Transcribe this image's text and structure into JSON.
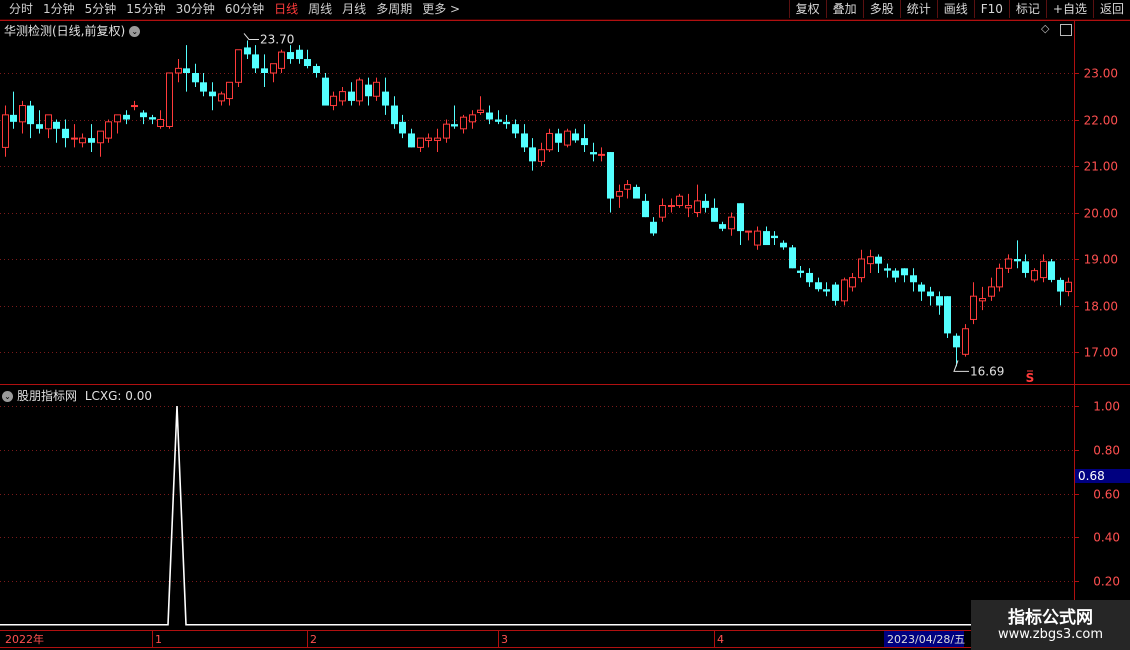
{
  "toolbar": {
    "periods": [
      {
        "label": "分时"
      },
      {
        "label": "1分钟"
      },
      {
        "label": "5分钟"
      },
      {
        "label": "15分钟"
      },
      {
        "label": "30分钟"
      },
      {
        "label": "60分钟"
      },
      {
        "label": "日线"
      },
      {
        "label": "周线"
      },
      {
        "label": "月线"
      },
      {
        "label": "多周期"
      },
      {
        "label": "更多"
      }
    ],
    "more_glyph": ">",
    "active_period": "日线",
    "buttons": [
      "复权",
      "叠加",
      "多股",
      "统计",
      "画线",
      "F10",
      "标记",
      "+自选",
      "返回"
    ]
  },
  "main_panel": {
    "title": "华测检测(日线,前复权)",
    "max_label": "23.70",
    "min_label": "16.69",
    "signal_mark": "S"
  },
  "indicator_panel": {
    "title": "股朋指标网",
    "value_label": "LCXG: 0.00",
    "current_value": "0.68"
  },
  "x_axis": {
    "start_label": "2022年",
    "month_labels": [
      "1",
      "2",
      "3",
      "4"
    ],
    "cursor_date": "2023/04/28/五"
  },
  "watermark": {
    "title": "指标公式网",
    "url": "www.zbgs3.com"
  },
  "colors": {
    "up": "#ff3b3b",
    "down": "#54ffff",
    "grid": "#7a1a1a",
    "axis": "#b01010",
    "label": "#ff5050",
    "indicator_line": "#ffffff",
    "highlight_bg": "#000080"
  },
  "chart_data": [
    {
      "type": "candlestick",
      "title": "华测检测(日线,前复权)",
      "y_ticks": [
        17,
        18,
        19,
        20,
        21,
        22,
        23
      ],
      "ylim": [
        16.5,
        24.0
      ],
      "annotations": [
        {
          "label": "23.70",
          "value": 23.7
        },
        {
          "label": "16.69",
          "value": 16.69
        }
      ],
      "ohlc": [
        [
          21.4,
          22.3,
          21.2,
          22.1
        ],
        [
          22.1,
          22.6,
          21.8,
          21.95
        ],
        [
          21.95,
          22.4,
          21.7,
          22.3
        ],
        [
          22.3,
          22.4,
          21.6,
          21.9
        ],
        [
          21.9,
          22.2,
          21.7,
          21.8
        ],
        [
          21.8,
          22.1,
          21.6,
          22.1
        ],
        [
          21.95,
          22.0,
          21.5,
          21.8
        ],
        [
          21.8,
          22.0,
          21.4,
          21.6
        ],
        [
          21.6,
          21.9,
          21.4,
          21.6
        ],
        [
          21.5,
          21.7,
          21.4,
          21.6
        ],
        [
          21.6,
          21.9,
          21.3,
          21.5
        ],
        [
          21.5,
          21.7,
          21.2,
          21.75
        ],
        [
          21.6,
          22.0,
          21.5,
          21.95
        ],
        [
          21.95,
          22.1,
          21.7,
          22.1
        ],
        [
          22.1,
          22.2,
          21.9,
          22.0
        ],
        [
          22.3,
          22.4,
          22.2,
          22.3
        ],
        [
          22.15,
          22.2,
          21.9,
          22.05
        ],
        [
          22.05,
          22.1,
          21.9,
          22.0
        ],
        [
          21.85,
          22.2,
          21.8,
          22.0
        ],
        [
          21.85,
          23.0,
          21.8,
          23.0
        ],
        [
          23.0,
          23.3,
          22.8,
          23.1
        ],
        [
          23.1,
          23.6,
          22.6,
          23.0
        ],
        [
          23.0,
          23.2,
          22.7,
          22.8
        ],
        [
          22.8,
          23.0,
          22.5,
          22.6
        ],
        [
          22.6,
          22.8,
          22.2,
          22.5
        ],
        [
          22.4,
          22.6,
          22.3,
          22.55
        ],
        [
          22.45,
          22.8,
          22.3,
          22.8
        ],
        [
          22.8,
          23.4,
          22.7,
          23.5
        ],
        [
          23.55,
          23.7,
          23.3,
          23.4
        ],
        [
          23.4,
          23.6,
          23.0,
          23.1
        ],
        [
          23.1,
          23.4,
          22.7,
          23.0
        ],
        [
          23.0,
          23.2,
          22.8,
          23.2
        ],
        [
          23.1,
          23.5,
          23.0,
          23.45
        ],
        [
          23.45,
          23.6,
          23.2,
          23.3
        ],
        [
          23.5,
          23.6,
          23.2,
          23.3
        ],
        [
          23.3,
          23.5,
          23.1,
          23.15
        ],
        [
          23.15,
          23.2,
          22.9,
          23.0
        ],
        [
          22.9,
          23.0,
          22.3,
          22.3
        ],
        [
          22.3,
          22.6,
          22.2,
          22.5
        ],
        [
          22.4,
          22.7,
          22.3,
          22.6
        ],
        [
          22.6,
          22.8,
          22.3,
          22.4
        ],
        [
          22.4,
          22.9,
          22.3,
          22.85
        ],
        [
          22.75,
          22.9,
          22.3,
          22.5
        ],
        [
          22.5,
          22.9,
          22.4,
          22.8
        ],
        [
          22.6,
          22.9,
          22.1,
          22.3
        ],
        [
          22.3,
          22.5,
          21.8,
          21.9
        ],
        [
          21.95,
          22.1,
          21.6,
          21.7
        ],
        [
          21.7,
          21.8,
          21.4,
          21.4
        ],
        [
          21.4,
          21.6,
          21.3,
          21.6
        ],
        [
          21.55,
          21.7,
          21.4,
          21.6
        ],
        [
          21.55,
          21.8,
          21.3,
          21.6
        ],
        [
          21.6,
          22.0,
          21.5,
          21.9
        ],
        [
          21.9,
          22.3,
          21.8,
          21.85
        ],
        [
          21.8,
          22.1,
          21.7,
          22.05
        ],
        [
          21.95,
          22.2,
          21.8,
          22.1
        ],
        [
          22.15,
          22.5,
          22.1,
          22.2
        ],
        [
          22.15,
          22.3,
          21.9,
          22.0
        ],
        [
          22.0,
          22.2,
          21.9,
          21.95
        ],
        [
          21.95,
          22.1,
          21.8,
          21.9
        ],
        [
          21.9,
          22.0,
          21.6,
          21.7
        ],
        [
          21.7,
          21.9,
          21.3,
          21.4
        ],
        [
          21.4,
          21.6,
          20.9,
          21.1
        ],
        [
          21.1,
          21.5,
          21.0,
          21.35
        ],
        [
          21.35,
          21.8,
          21.3,
          21.7
        ],
        [
          21.7,
          21.8,
          21.3,
          21.5
        ],
        [
          21.45,
          21.8,
          21.4,
          21.75
        ],
        [
          21.7,
          21.8,
          21.5,
          21.55
        ],
        [
          21.6,
          21.9,
          21.3,
          21.45
        ],
        [
          21.3,
          21.5,
          21.1,
          21.25
        ],
        [
          21.25,
          21.4,
          21.1,
          21.25
        ],
        [
          21.3,
          21.3,
          20.0,
          20.3
        ],
        [
          20.35,
          20.6,
          20.1,
          20.45
        ],
        [
          20.5,
          20.7,
          20.3,
          20.6
        ],
        [
          20.55,
          20.6,
          20.3,
          20.3
        ],
        [
          20.25,
          20.4,
          19.9,
          19.9
        ],
        [
          19.8,
          19.9,
          19.5,
          19.55
        ],
        [
          19.9,
          20.3,
          19.8,
          20.15
        ],
        [
          20.15,
          20.3,
          20.0,
          20.15
        ],
        [
          20.15,
          20.4,
          20.1,
          20.35
        ],
        [
          20.1,
          20.4,
          19.9,
          20.15
        ],
        [
          20.0,
          20.6,
          19.9,
          20.25
        ],
        [
          20.25,
          20.4,
          20.0,
          20.1
        ],
        [
          20.1,
          20.3,
          19.8,
          19.8
        ],
        [
          19.75,
          19.8,
          19.6,
          19.65
        ],
        [
          19.65,
          20.0,
          19.5,
          19.9
        ],
        [
          20.2,
          20.2,
          19.3,
          19.6
        ],
        [
          19.6,
          19.6,
          19.4,
          19.6
        ],
        [
          19.3,
          19.7,
          19.2,
          19.6
        ],
        [
          19.6,
          19.7,
          19.3,
          19.3
        ],
        [
          19.5,
          19.6,
          19.3,
          19.45
        ],
        [
          19.35,
          19.4,
          19.2,
          19.25
        ],
        [
          19.25,
          19.3,
          18.8,
          18.8
        ],
        [
          18.75,
          18.85,
          18.6,
          18.7
        ],
        [
          18.7,
          18.8,
          18.4,
          18.5
        ],
        [
          18.5,
          18.6,
          18.3,
          18.35
        ],
        [
          18.35,
          18.5,
          18.2,
          18.3
        ],
        [
          18.45,
          18.5,
          18.0,
          18.1
        ],
        [
          18.1,
          18.6,
          18.0,
          18.55
        ],
        [
          18.4,
          18.7,
          18.3,
          18.6
        ],
        [
          18.6,
          19.2,
          18.5,
          19.0
        ],
        [
          18.9,
          19.2,
          18.7,
          19.05
        ],
        [
          19.05,
          19.1,
          18.7,
          18.9
        ],
        [
          18.8,
          18.9,
          18.6,
          18.75
        ],
        [
          18.75,
          18.8,
          18.5,
          18.6
        ],
        [
          18.8,
          18.8,
          18.5,
          18.65
        ],
        [
          18.65,
          18.8,
          18.3,
          18.5
        ],
        [
          18.45,
          18.5,
          18.1,
          18.3
        ],
        [
          18.3,
          18.4,
          18.0,
          18.2
        ],
        [
          18.2,
          18.3,
          17.8,
          18.0
        ],
        [
          18.2,
          18.2,
          17.3,
          17.4
        ],
        [
          17.35,
          17.4,
          16.69,
          17.1
        ],
        [
          16.95,
          17.6,
          16.9,
          17.5
        ],
        [
          17.7,
          18.5,
          17.6,
          18.2
        ],
        [
          18.1,
          18.4,
          17.9,
          18.15
        ],
        [
          18.2,
          18.6,
          18.1,
          18.4
        ],
        [
          18.4,
          18.9,
          18.3,
          18.8
        ],
        [
          18.8,
          19.1,
          18.7,
          19.0
        ],
        [
          19.0,
          19.4,
          18.8,
          18.95
        ],
        [
          18.95,
          19.1,
          18.6,
          18.7
        ],
        [
          18.55,
          18.8,
          18.5,
          18.75
        ],
        [
          18.6,
          19.1,
          18.5,
          18.95
        ],
        [
          18.95,
          19.0,
          18.5,
          18.55
        ],
        [
          18.55,
          18.6,
          18.0,
          18.3
        ],
        [
          18.3,
          18.6,
          18.2,
          18.5
        ]
      ]
    },
    {
      "type": "line",
      "title": "股朋指标网",
      "series": [
        {
          "name": "LCXG"
        }
      ],
      "y_ticks": [
        0.2,
        0.4,
        0.6,
        0.8,
        1.0
      ],
      "ylim": [
        0,
        1.1
      ],
      "baseline": 0,
      "spike": {
        "bar_index": 20,
        "value": 1.0
      }
    }
  ]
}
